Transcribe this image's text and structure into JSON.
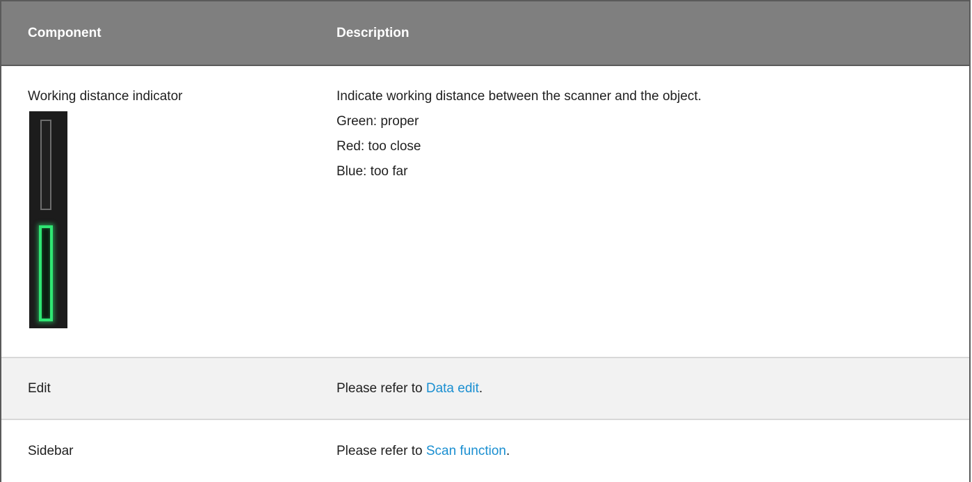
{
  "table": {
    "headers": {
      "component": "Component",
      "description": "Description"
    },
    "rows": [
      {
        "component": "Working distance indicator",
        "description": [
          "Indicate working distance between the scanner and the object.",
          "Green: proper",
          "Red: too close",
          "Blue: too far"
        ],
        "indicator": {
          "state": "proper",
          "active_color": "#2fe673",
          "inactive_color": "#6d6d6d"
        }
      },
      {
        "component": "Edit",
        "description_prefix": "Please refer to ",
        "link_text": "Data edit",
        "description_suffix": "."
      },
      {
        "component": "Sidebar",
        "description_prefix": "Please refer to ",
        "link_text": "Scan function",
        "description_suffix": "."
      }
    ]
  },
  "colors": {
    "header_bg": "#7f7f7f",
    "link": "#1a8fd1",
    "alt_row_bg": "#f2f2f2"
  }
}
